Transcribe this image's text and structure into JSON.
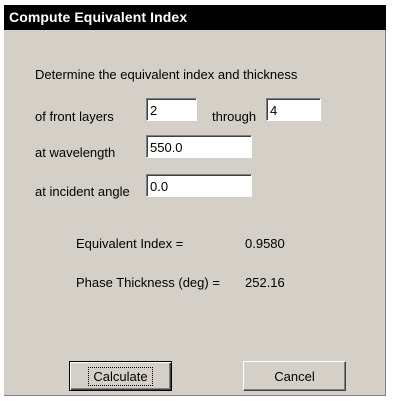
{
  "dialog": {
    "title": "Compute Equivalent Index",
    "intro_text": "Determine the equivalent index and thickness",
    "front_layers_label": "of front layers",
    "from_layer_value": "2",
    "through_label": "through",
    "to_layer_value": "4",
    "wavelength_label": "at wavelength",
    "wavelength_value": "550.0",
    "incident_angle_label": "at incident angle",
    "incident_angle_value": "0.0",
    "equivalent_index_label": "Equivalent Index =",
    "equivalent_index_value": "0.9580",
    "phase_thickness_label": "Phase Thickness (deg) =",
    "phase_thickness_value": "252.16",
    "calculate_label": "Calculate",
    "cancel_label": "Cancel"
  },
  "colors": {
    "dialog_background": "#d4d0c8",
    "titlebar_background": "#000000",
    "titlebar_text": "#ffffff"
  }
}
